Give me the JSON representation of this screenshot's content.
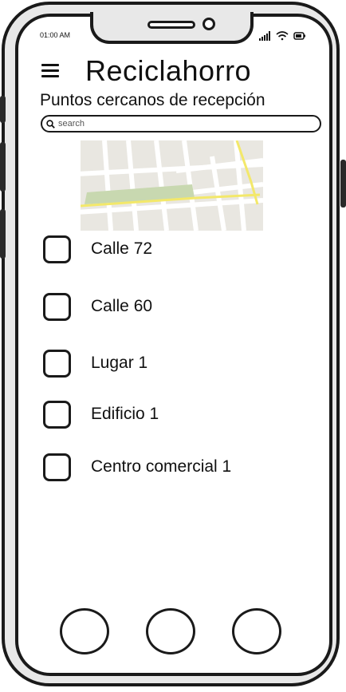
{
  "status_bar": {
    "time": "01:00 AM",
    "icons": [
      "signal-icon",
      "wifi-icon",
      "battery-icon"
    ]
  },
  "header": {
    "menu_icon": "hamburger-icon",
    "title": "Reciclahorro",
    "subtitle": "Puntos cercanos de recepción"
  },
  "search": {
    "placeholder": "search",
    "value": ""
  },
  "map": {
    "icon": "map-thumbnail"
  },
  "locations": [
    {
      "label": "Calle 72",
      "checked": false
    },
    {
      "label": "Calle 60",
      "checked": false
    },
    {
      "label": "Lugar 1",
      "checked": false
    },
    {
      "label": "Edificio 1",
      "checked": false
    },
    {
      "label": "Centro comercial 1",
      "checked": false
    }
  ],
  "bottom_nav": {
    "buttons": 3
  }
}
